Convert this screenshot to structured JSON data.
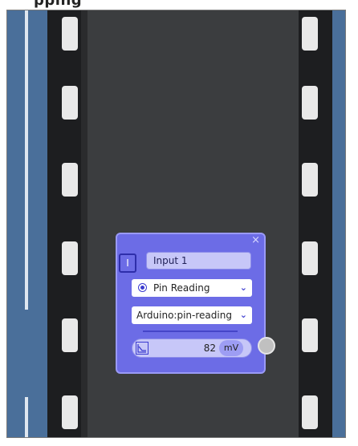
{
  "header": {
    "title": "pping"
  },
  "node": {
    "io_label": "I",
    "name_value": "Input 1",
    "mode_selected": "Pin Reading",
    "source_selected": "Arduino:pin-reading",
    "reading_value": "82",
    "reading_unit": "mV",
    "close_glyph": "×",
    "dropdown_glyph": "⌄"
  },
  "colors": {
    "node_bg": "#6c6ce6",
    "field_bg": "#c7c7f8",
    "accent": "#3b3bcf",
    "road": "#3b3d3f",
    "side_blue": "#4a6f9a"
  },
  "icons": [
    "close-icon",
    "radio-selected-icon",
    "chevron-down-icon",
    "graph-icon",
    "connector-port-icon"
  ]
}
